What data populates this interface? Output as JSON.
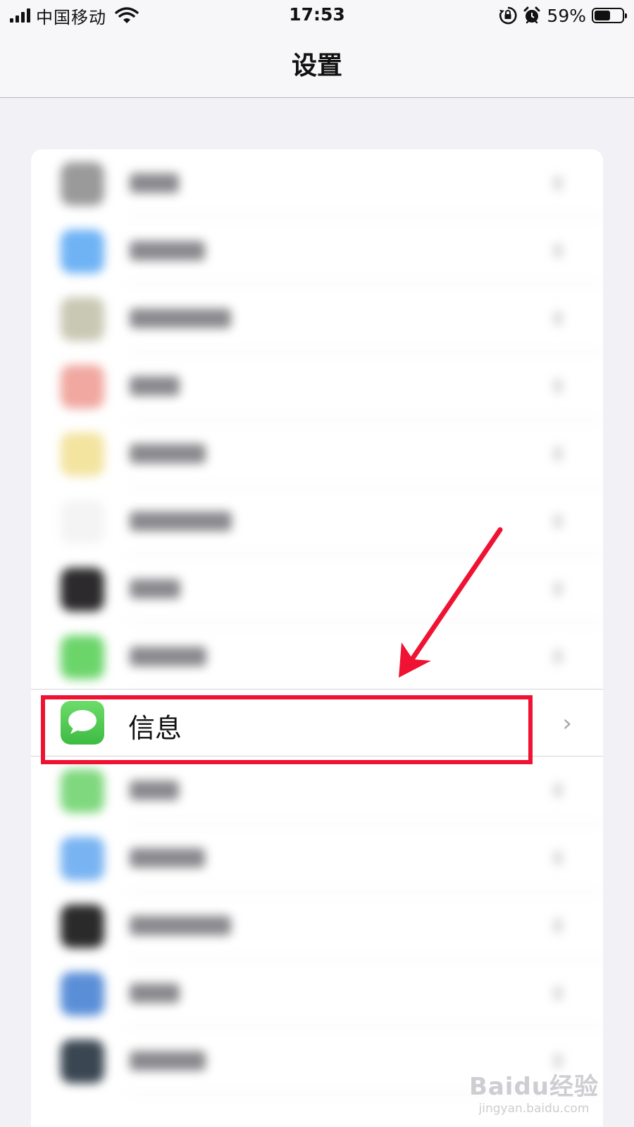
{
  "status_bar": {
    "carrier": "中国移动",
    "time": "17:53",
    "battery": "59%",
    "battery_level": 0.59,
    "icons": [
      "signal-icon",
      "wifi-icon",
      "orientation-lock-icon",
      "alarm-icon",
      "battery-icon"
    ]
  },
  "nav": {
    "title": "设置"
  },
  "list": {
    "blurred_rows": [
      {
        "icon": "blurred-app-icon",
        "color": "#9a9a9a"
      },
      {
        "icon": "blurred-app-icon",
        "color": "#6fb3f5"
      },
      {
        "icon": "blurred-app-icon",
        "color": "#c9c8b4"
      },
      {
        "icon": "blurred-app-icon",
        "color": "#f0a8a0"
      },
      {
        "icon": "blurred-app-icon",
        "color": "#f3e4a0"
      },
      {
        "icon": "blurred-app-icon",
        "color": "#f4f4f4"
      },
      {
        "icon": "blurred-app-icon",
        "color": "#2c2a2c"
      },
      {
        "icon": "blurred-app-icon",
        "color": "#6bd56a"
      }
    ],
    "focused_row": {
      "label": "信息",
      "icon": "messages-icon",
      "chevron": "›"
    },
    "blurred_rows_below": [
      {
        "icon": "blurred-app-icon",
        "color": "#7fd87e"
      },
      {
        "icon": "blurred-app-icon",
        "color": "#79b4f2"
      },
      {
        "icon": "blurred-app-icon",
        "color": "#2a2a2a"
      },
      {
        "icon": "blurred-app-icon",
        "color": "#5a8fd8"
      },
      {
        "icon": "blurred-app-icon",
        "color": "#3a4652"
      }
    ]
  },
  "annotation": {
    "color": "#ef1233"
  },
  "watermark": {
    "logo": "Baidu经验",
    "url": "jingyan.baidu.com"
  }
}
